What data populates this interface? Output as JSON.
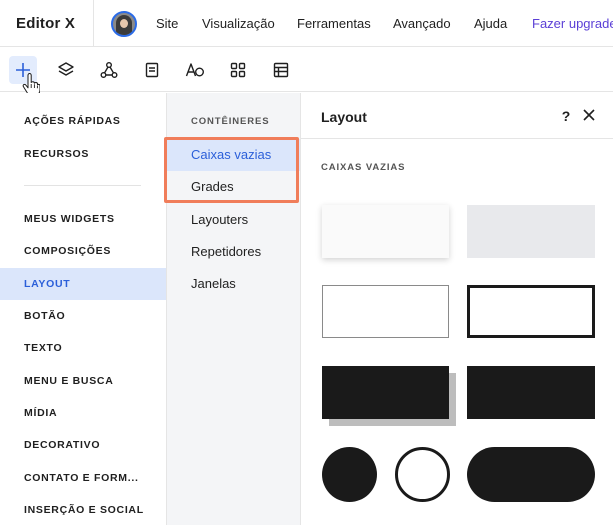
{
  "app": {
    "brand": "Editor X"
  },
  "top_menu": {
    "items": [
      "Site",
      "Visualização",
      "Ferramentas",
      "Avançado",
      "Ajuda"
    ],
    "upgrade": "Fazer upgrade"
  },
  "toolbar": {
    "tools": [
      "add-icon",
      "layers-icon",
      "connections-icon",
      "pages-icon",
      "fonts-icon",
      "apps-icon",
      "table-icon"
    ],
    "active_tool": "add-icon"
  },
  "categories": {
    "top": [
      "AÇÕES RÁPIDAS",
      "RECURSOS"
    ],
    "items": [
      "MEUS WIDGETS",
      "COMPOSIÇÕES",
      "LAYOUT",
      "BOTÃO",
      "TEXTO",
      "MENU E BUSCA",
      "MÍDIA",
      "DECORATIVO",
      "CONTATO E FORM...",
      "INSERÇÃO E SOCIAL"
    ],
    "active": "LAYOUT"
  },
  "subcategories": {
    "heading": "CONTÊINERES",
    "items": [
      "Caixas vazias",
      "Grades",
      "Layouters",
      "Repetidores",
      "Janelas"
    ],
    "active": "Caixas vazias"
  },
  "panel": {
    "title": "Layout",
    "help": "?",
    "section_title": "CAIXAS VAZIAS"
  },
  "colors": {
    "accent_blue": "#2b5fd9",
    "active_bg": "#dbe6fb",
    "highlight_border": "#f07d5a",
    "upgrade_purple": "#5b3fd6"
  }
}
